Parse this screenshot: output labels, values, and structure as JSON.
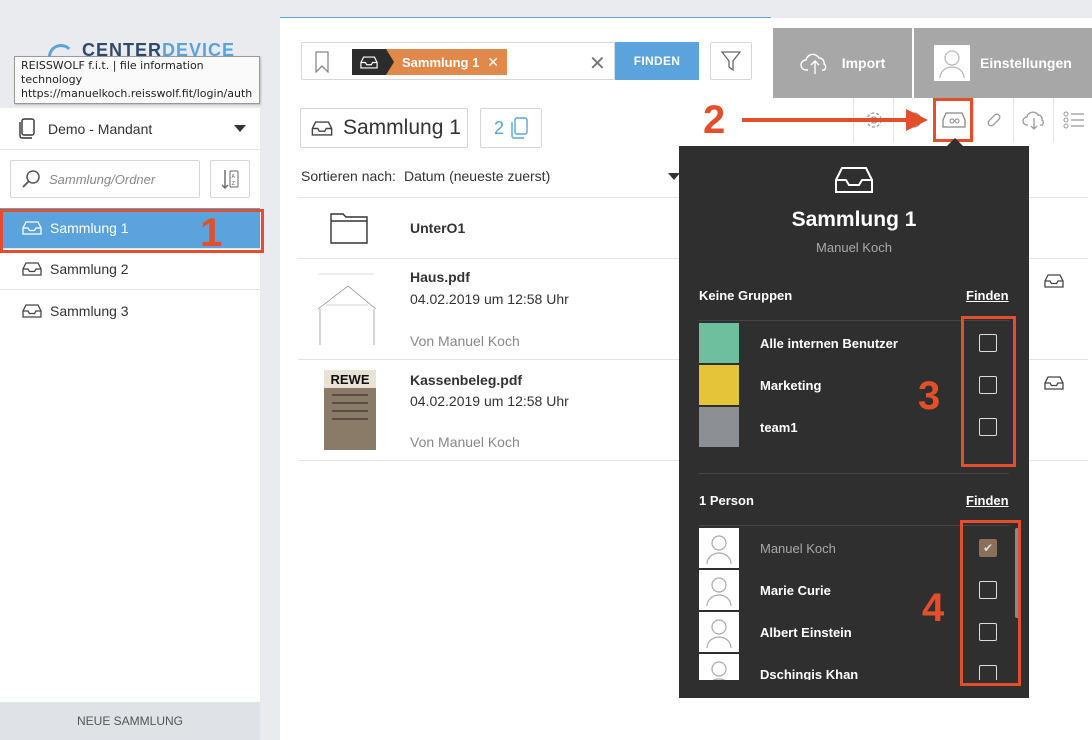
{
  "tooltip": {
    "line1": "REISSWOLF f.i.t. | file information technology",
    "line2": "https://manuelkoch.reisswolf.fit/login/auth"
  },
  "logo": {
    "part1": "CENTER",
    "part2": "DEVICE"
  },
  "sidebar": {
    "mandant": "Demo - Mandant",
    "search_placeholder": "Sammlung/Ordner",
    "collections": [
      {
        "label": "Sammlung 1",
        "active": true
      },
      {
        "label": "Sammlung 2",
        "active": false
      },
      {
        "label": "Sammlung 3",
        "active": false
      }
    ],
    "new_button": "NEUE SAMMLUNG"
  },
  "search": {
    "chip_label": "Sammlung 1",
    "find_button": "FINDEN"
  },
  "header": {
    "import_label": "Import",
    "settings_label": "Einstellungen",
    "title": "Sammlung 1",
    "count": "2"
  },
  "sort": {
    "label": "Sortieren nach:",
    "value": "Datum (neueste zuerst)"
  },
  "files": [
    {
      "name": "UnterO1",
      "type": "folder"
    },
    {
      "name": "Haus.pdf",
      "date": "04.02.2019 um 12:58 Uhr",
      "author": "Von Manuel Koch"
    },
    {
      "name": "Kassenbeleg.pdf",
      "date": "04.02.2019 um 12:58 Uhr",
      "author": "Von Manuel Koch",
      "thumb_text": "REWE"
    }
  ],
  "popover": {
    "title": "Sammlung 1",
    "owner": "Manuel Koch",
    "groups_title": "Keine Gruppen",
    "groups_link": "Finden",
    "groups": [
      {
        "name": "Alle internen Benutzer",
        "color": "#6dbf9d",
        "checked": false
      },
      {
        "name": "Marketing",
        "color": "#e6c43a",
        "checked": false
      },
      {
        "name": "team1",
        "color": "#8c9094",
        "checked": false
      }
    ],
    "people_title": "1 Person",
    "people_link": "Finden",
    "people": [
      {
        "name": "Manuel Koch",
        "checked": true,
        "owner": true
      },
      {
        "name": "Marie Curie",
        "checked": false
      },
      {
        "name": "Albert Einstein",
        "checked": false
      },
      {
        "name": "Dschingis Khan",
        "checked": false
      }
    ]
  },
  "annotations": [
    "1",
    "2",
    "3",
    "4"
  ],
  "colors": {
    "accent": "#5aa3dc",
    "annotation": "#e1502a",
    "chip": "#e0894a",
    "popover": "#2f2f2f"
  }
}
